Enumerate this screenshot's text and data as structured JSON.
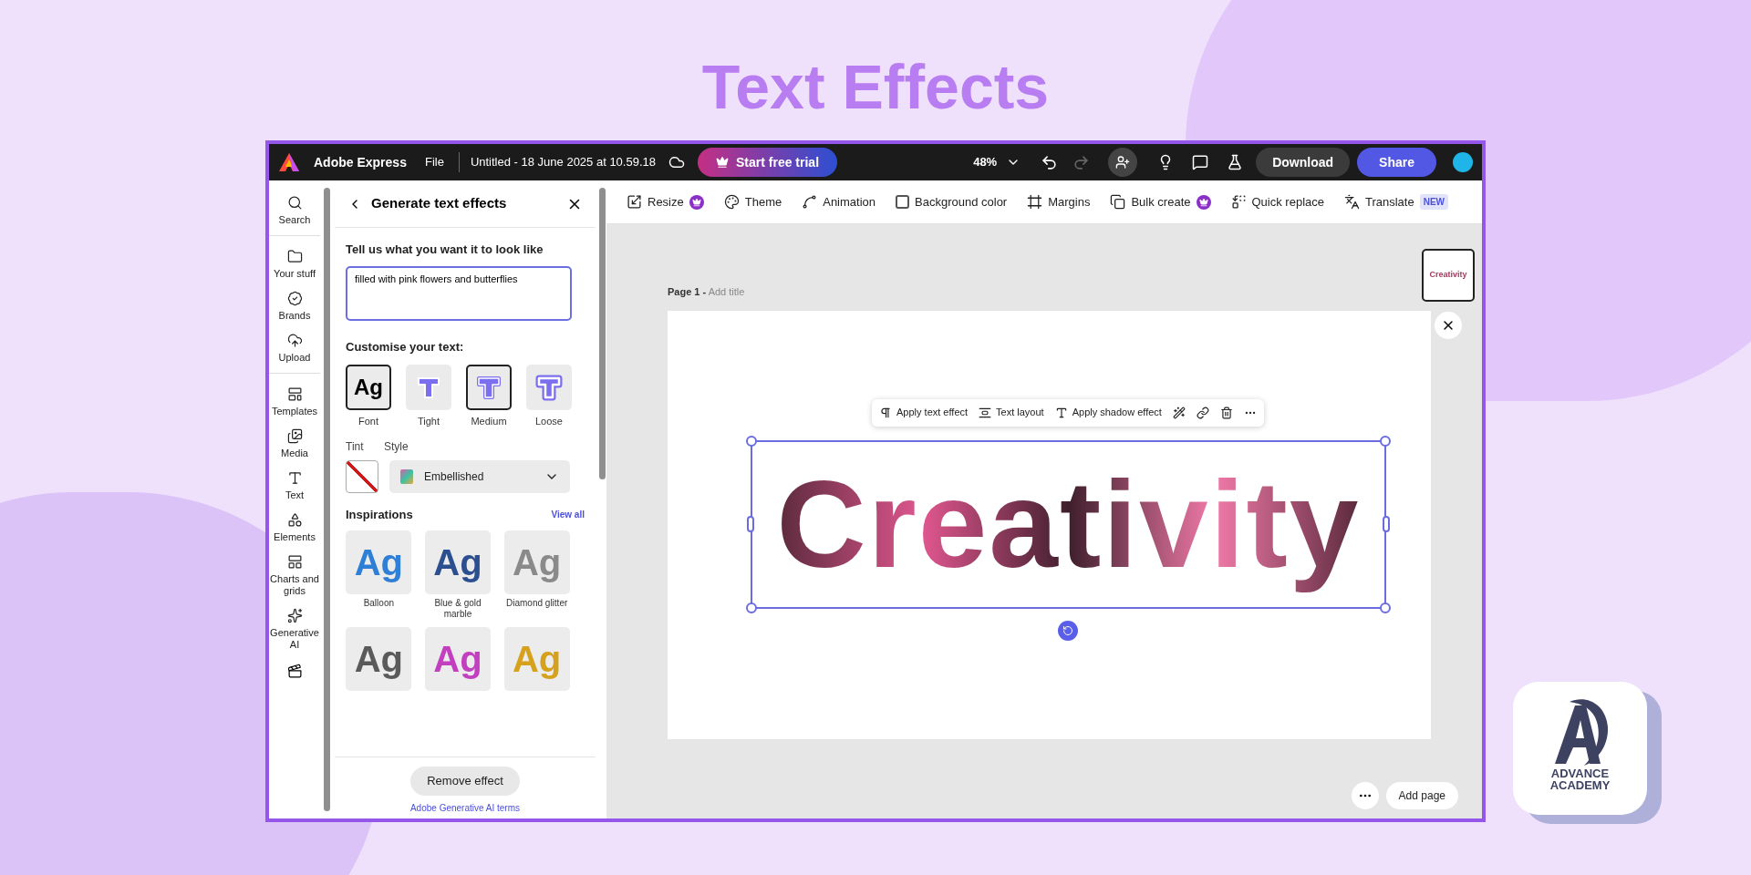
{
  "header": {
    "title": "Text Effects"
  },
  "top_bar": {
    "app_name": "Adobe Express",
    "menu": "File",
    "document_title": "Untitled - 18 June 2025 at 10.59.18",
    "trial_button": "Start free trial",
    "zoom": "48%",
    "redo_disabled": true,
    "download": "Download",
    "share": "Share"
  },
  "toolbar": [
    {
      "kind": "action",
      "label": "Resize",
      "premium": true
    },
    {
      "kind": "action",
      "label": "Theme",
      "premium": false
    },
    {
      "kind": "action",
      "label": "Animation",
      "premium": false
    },
    {
      "kind": "checkbox",
      "label": "Background color",
      "checked": false,
      "premium": false
    },
    {
      "kind": "action",
      "label": "Margins",
      "premium": false
    },
    {
      "kind": "action",
      "label": "Bulk create",
      "premium": true
    },
    {
      "kind": "action",
      "label": "Quick replace",
      "premium": false
    },
    {
      "kind": "action",
      "label": "Translate",
      "premium": false,
      "badge": "NEW"
    }
  ],
  "sidebar": {
    "items": [
      {
        "label": "Search",
        "divider_after": true
      },
      {
        "label": "Your stuff",
        "divider_after": false
      },
      {
        "label": "Brands",
        "divider_after": false
      },
      {
        "label": "Upload",
        "divider_after": true
      },
      {
        "label": "Templates",
        "divider_after": false
      },
      {
        "label": "Media",
        "divider_after": false
      },
      {
        "label": "Text",
        "divider_after": false
      },
      {
        "label": "Elements",
        "divider_after": false
      },
      {
        "label": "Charts and grids",
        "divider_after": false
      },
      {
        "label": "Generative AI",
        "divider_after": false
      }
    ]
  },
  "panel": {
    "title": "Generate text effects",
    "prompt_label": "Tell us what you want it to look like",
    "prompt_value": "filled with pink flowers and butterflies",
    "customise_label": "Customise your text:",
    "options": [
      {
        "kind": "font",
        "sample": "Ag",
        "label": "Font",
        "selected": true
      },
      {
        "kind": "tight",
        "label": "Tight",
        "selected": false
      },
      {
        "kind": "medium",
        "label": "Medium",
        "selected": true
      },
      {
        "kind": "loose",
        "label": "Loose",
        "selected": false
      }
    ],
    "tint_label": "Tint",
    "style_label": "Style",
    "style_value": "Embellished",
    "inspirations_label": "Inspirations",
    "view_all": "View all",
    "inspirations": [
      {
        "sample": "Ag",
        "label": "Balloon",
        "color": "#2f7fd6"
      },
      {
        "sample": "Ag",
        "label": "Blue & gold marble",
        "color": "#2c4f8f"
      },
      {
        "sample": "Ag",
        "label": "Diamond glitter",
        "color": "#8a8a8a"
      },
      {
        "sample": "Ag",
        "color": "#5a5a5a"
      },
      {
        "sample": "Ag",
        "color": "#c23fbf"
      },
      {
        "sample": "Ag",
        "color": "#d6a21e"
      }
    ],
    "remove_button": "Remove effect",
    "terms_link": "Adobe Generative AI terms"
  },
  "canvas": {
    "page_label": "Page 1 -",
    "page_title_placeholder": "Add title",
    "thumbnail_text": "Creativity",
    "artwork_text": "Creativity",
    "context_toolbar": [
      "Apply text effect",
      "Text layout",
      "Apply shadow effect"
    ],
    "add_page": "Add page"
  },
  "logo": {
    "lines": [
      "ADVANCE",
      "ACADEMY"
    ]
  }
}
